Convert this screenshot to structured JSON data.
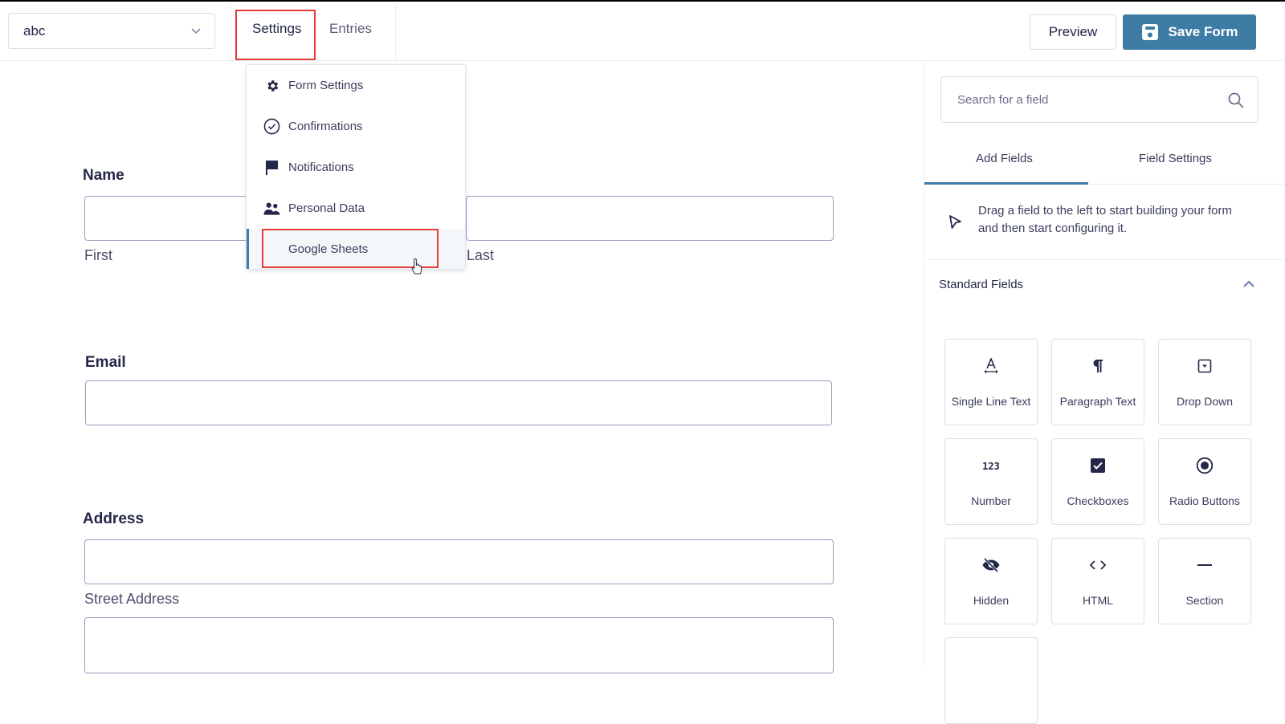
{
  "header": {
    "form_selector": {
      "value": "abc"
    },
    "nav_tabs": [
      {
        "label": "Settings",
        "highlighted": true
      },
      {
        "label": "Entries"
      }
    ],
    "preview_label": "Preview",
    "save_label": "Save Form",
    "accent_color": "#3e7ba5",
    "highlight_color": "#e53935"
  },
  "settings_menu": {
    "items": [
      {
        "label": "Form Settings",
        "icon": "gear-icon"
      },
      {
        "label": "Confirmations",
        "icon": "check-circle-icon"
      },
      {
        "label": "Notifications",
        "icon": "flag-icon"
      },
      {
        "label": "Personal Data",
        "icon": "users-icon"
      },
      {
        "label": "Google Sheets",
        "icon": "none",
        "active": true,
        "highlighted": true
      }
    ]
  },
  "form": {
    "fields": [
      {
        "label": "Name",
        "sub_labels": [
          "First",
          "Last"
        ]
      },
      {
        "label": "Email"
      },
      {
        "label": "Address",
        "sub_labels": [
          "Street Address"
        ]
      }
    ]
  },
  "panel": {
    "search": {
      "placeholder": "Search for a field",
      "value": ""
    },
    "tabs": [
      {
        "label": "Add Fields",
        "active": true
      },
      {
        "label": "Field Settings"
      }
    ],
    "hint": "Drag a field to the left to start building your form and then start configuring it.",
    "section_title": "Standard Fields",
    "tiles": [
      {
        "label": "Single Line Text",
        "icon": "single-line-text-icon"
      },
      {
        "label": "Paragraph Text",
        "icon": "pilcrow-icon"
      },
      {
        "label": "Drop Down",
        "icon": "dropdown-icon"
      },
      {
        "label": "Number",
        "icon": "number-icon"
      },
      {
        "label": "Checkboxes",
        "icon": "checkbox-icon"
      },
      {
        "label": "Radio Buttons",
        "icon": "radio-icon"
      },
      {
        "label": "Hidden",
        "icon": "eye-slash-icon"
      },
      {
        "label": "HTML",
        "icon": "code-icon"
      },
      {
        "label": "Section",
        "icon": "minus-icon"
      }
    ]
  }
}
